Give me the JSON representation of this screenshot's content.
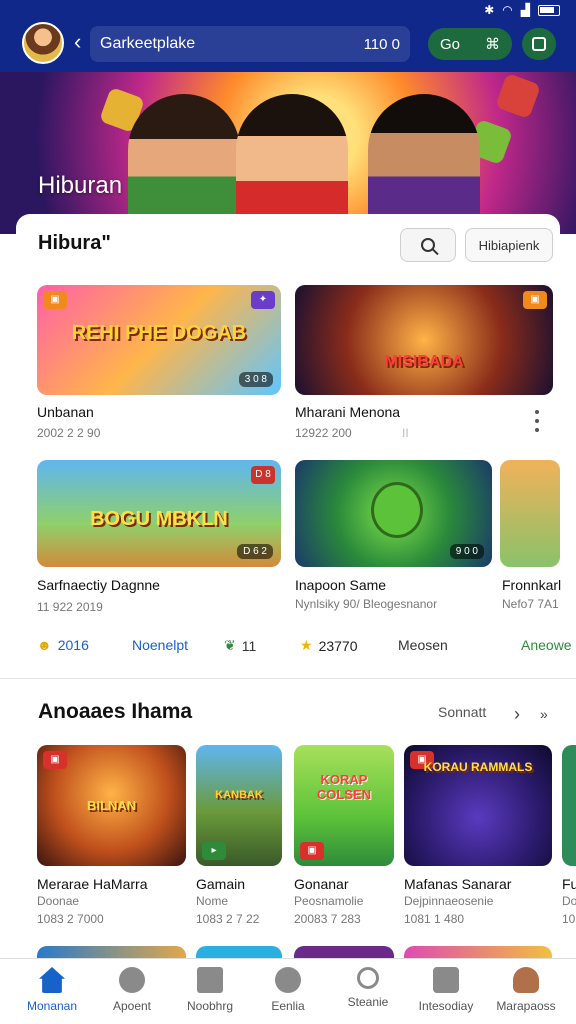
{
  "status_bar": {
    "icons": [
      "bluetooth-icon",
      "wifi-icon",
      "signal-icon",
      "battery-icon"
    ]
  },
  "header": {
    "search_value": "Garkeetplake",
    "search_count": "110 0",
    "go_label": "Go"
  },
  "hero": {
    "title": "Hiburan"
  },
  "section1": {
    "title": "Hibura\"",
    "filter_label": "Hibiapienk",
    "games": [
      {
        "title": "Unbanan",
        "meta": "2002 2 2 90",
        "badge": "",
        "tag": "3 0 8",
        "art": "REHI PHE DOGAB"
      },
      {
        "title": "Mharani Menona",
        "meta": "12922 200",
        "badge": "",
        "tag": "",
        "art": "MISIBADA"
      },
      {
        "title": "Sarfnaectiy Dagnne",
        "meta": "11 922 2019",
        "badge": "D 8",
        "tag": "D 6 2",
        "art": "BOGU MBKLN"
      },
      {
        "title": "Inapoon Same",
        "meta": "Nynlsiky 90/ Bleogesnanor",
        "badge": "",
        "tag": "9 0 0",
        "art": ""
      },
      {
        "title": "Fronnkarl",
        "meta": "Nefo7 7A1",
        "badge": "",
        "tag": "",
        "art": ""
      }
    ],
    "kebab_hidden_text": "II"
  },
  "stats": [
    {
      "icon": "smile-icon",
      "value": "2016",
      "color": "#1762c9"
    },
    {
      "label": "Noenelpt",
      "color": "#1762c9"
    },
    {
      "icon": "leaf-icon",
      "value": "11",
      "color": "#2e8b3a"
    },
    {
      "icon": "star-icon",
      "value": "23770",
      "color": "#222222"
    },
    {
      "label": "Meosen",
      "color": "#333333"
    },
    {
      "label": "Aneowe",
      "color": "#2e8b3a"
    }
  ],
  "section2": {
    "title": "Anoaaes Ihama",
    "see_all": "Sonnatt",
    "games": [
      {
        "title": "Merarae HaMarra",
        "meta1": "Doonae",
        "meta2": "1083 2 7000",
        "art": "BILNAN"
      },
      {
        "title": "Gamain",
        "meta1": "Nome",
        "meta2": "1083 2 7 22",
        "art": "KANBAK"
      },
      {
        "title": "Gonanar",
        "meta1": "Peosnamolie",
        "meta2": "20083 7 283",
        "art": "KORAP COLSEN"
      },
      {
        "title": "Mafanas Sanarar",
        "meta1": "Dejpinnaeosenie",
        "meta2": "1081 1 480",
        "art": "KORAU RAMMALS"
      },
      {
        "title": "Fu",
        "meta1": "Do",
        "meta2": "10",
        "art": ""
      }
    ]
  },
  "bottom_nav": [
    {
      "label": "Monanan",
      "icon": "home-icon",
      "active": true
    },
    {
      "label": "Apoent",
      "icon": "apps-icon",
      "active": false
    },
    {
      "label": "Noobhrg",
      "icon": "folder-icon",
      "active": false
    },
    {
      "label": "Eenlia",
      "icon": "add-icon",
      "active": false
    },
    {
      "label": "Steanie",
      "icon": "search-icon",
      "active": false
    },
    {
      "label": "Intesodiay",
      "icon": "chat-icon",
      "active": false
    },
    {
      "label": "Marapaoss",
      "icon": "profile-icon",
      "active": false
    }
  ],
  "colors": {
    "header_bg": "#10288a",
    "accent": "#1762c9",
    "green_pill": "#1d6a3e",
    "badge_orange": "#f08a1c"
  }
}
